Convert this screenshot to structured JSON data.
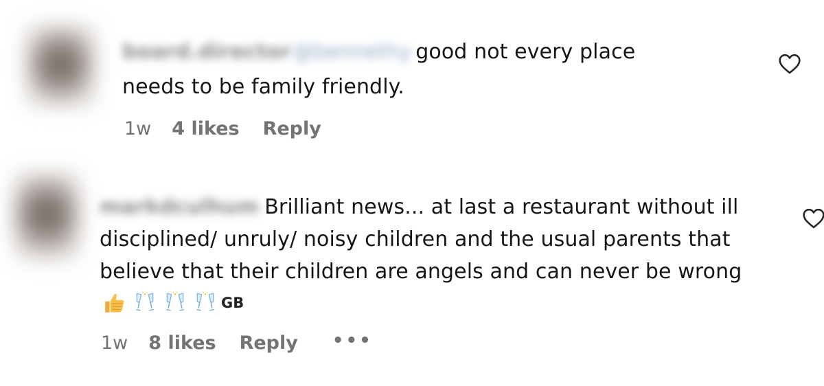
{
  "comments": [
    {
      "username": "board.director",
      "mention": "@bennethy",
      "text_line1": "good not every place",
      "text_line2": "needs to be family friendly.",
      "time": "1w",
      "likes": "4 likes",
      "reply": "Reply",
      "icons": {
        "like": "heart-outline-icon"
      }
    },
    {
      "username": "markdculhum",
      "text_line1": "Brilliant news... at last a restaurant without ill",
      "text_line2": "disciplined/ unruly/ noisy children and the usual parents that",
      "text_line3": "believe that their children are angels and can never be wrong",
      "emoji_suffix": "GB",
      "time": "1w",
      "likes": "8 likes",
      "reply": "Reply",
      "more": "•••",
      "icons": {
        "like": "heart-outline-icon",
        "emojis": [
          "thumbs-up-emoji",
          "champagne-glasses-emoji",
          "champagne-glasses-emoji",
          "champagne-glasses-emoji"
        ]
      }
    }
  ],
  "colors": {
    "text": "#161616",
    "meta": "#737373",
    "mention": "#8fa9c4"
  }
}
